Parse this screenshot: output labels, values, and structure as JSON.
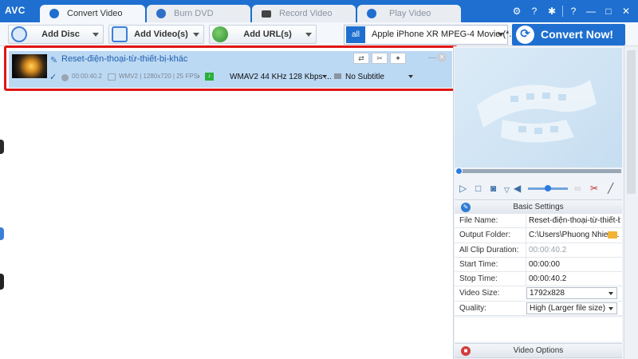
{
  "app": {
    "logo": "AVC"
  },
  "tabs": [
    {
      "label": "Convert Video",
      "active": true
    },
    {
      "label": "Burn DVD",
      "active": false
    },
    {
      "label": "Record Video",
      "active": false
    },
    {
      "label": "Play Video",
      "active": false
    }
  ],
  "window_controls": {
    "help": "?",
    "minimize": "—",
    "maximize": "□",
    "close": "✕"
  },
  "toolbar": {
    "add_disc": "Add Disc",
    "add_videos": "Add Video(s)",
    "add_urls": "Add URL(s)",
    "profile_icon_text": "all",
    "profile": "Apple iPhone XR MPEG-4 Movie (*.m...",
    "convert_now": "Convert Now!"
  },
  "file_item": {
    "title": "Reset-điện-thoại-từ-thiết-bị-khác",
    "duration": "00:00:40.2",
    "video_info": "WMV2 | 1280x720 | 25 FPS",
    "audio_track": "WMAV2 44 KHz 128 Kbps ...",
    "subtitle": "No Subtitle"
  },
  "basic_settings": {
    "header": "Basic Settings",
    "rows": [
      {
        "name": "File Name:",
        "value": "Reset-điện-thoại-từ-thiết-bị..."
      },
      {
        "name": "Output Folder:",
        "value": "C:\\Users\\Phuong Nhien..."
      },
      {
        "name": "All Clip Duration:",
        "value": "00:00:40.2"
      },
      {
        "name": "Start Time:",
        "value": "00:00:00"
      },
      {
        "name": "Stop Time:",
        "value": "00:00:40.2"
      },
      {
        "name": "Video Size:",
        "value": "1792x828"
      },
      {
        "name": "Quality:",
        "value": "High (Larger file size)"
      }
    ]
  },
  "video_options": {
    "header": "Video Options"
  },
  "colors": {
    "brand_blue": "#1e6fcf",
    "item_bg": "#bcd9f4",
    "highlight_red": "#e01515"
  }
}
